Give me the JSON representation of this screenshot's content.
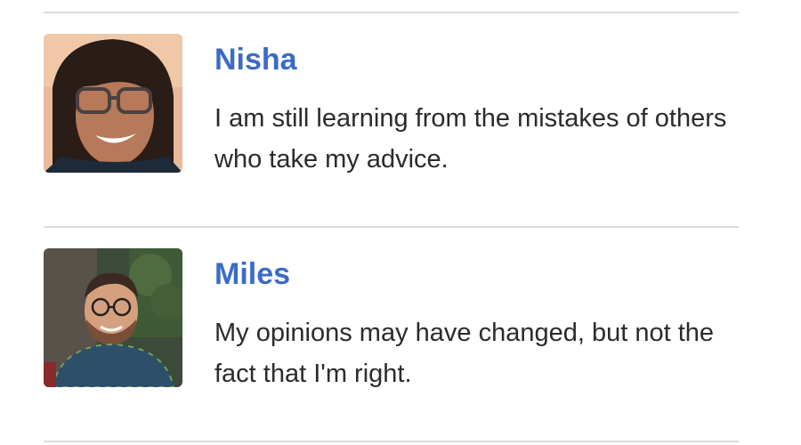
{
  "comments": [
    {
      "name": "Nisha",
      "avatar_icon": "user-avatar-photo",
      "quote": "I am still learning from the mistakes of others who take my advice."
    },
    {
      "name": "Miles",
      "avatar_icon": "user-avatar-photo",
      "quote": "My opinions may have changed, but not the fact that I'm right."
    }
  ],
  "colors": {
    "name_link": "#3b6bc6",
    "divider": "#dcdcdc",
    "body_text": "#2b2b2b"
  }
}
